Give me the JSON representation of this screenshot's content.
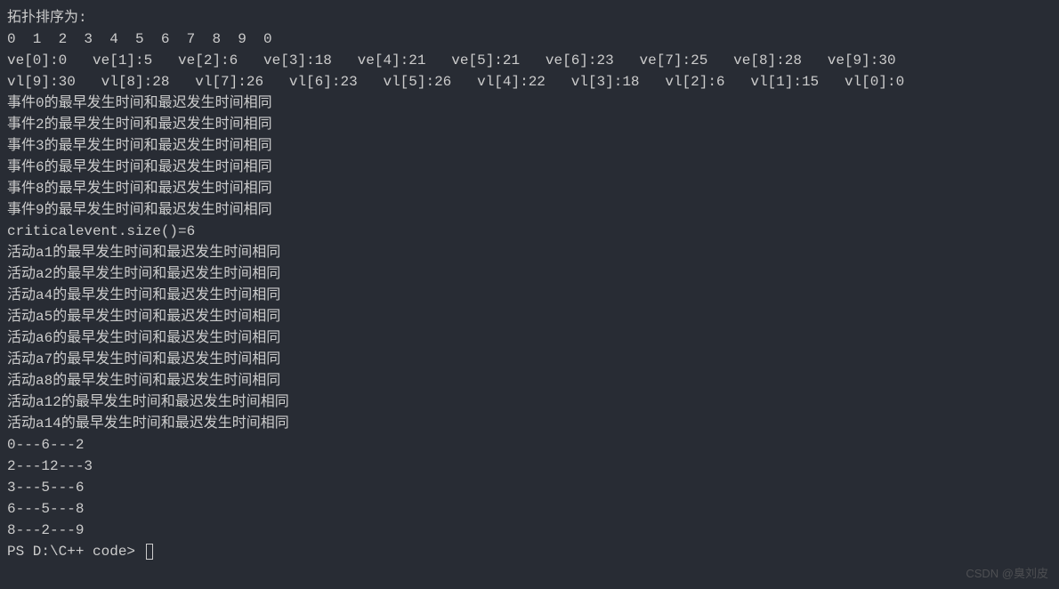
{
  "lines": {
    "header": "拓扑排序为:",
    "topo_order": "0  1  2  3  4  5  6  7  8  9  0",
    "ve_line": "ve[0]:0   ve[1]:5   ve[2]:6   ve[3]:18   ve[4]:21   ve[5]:21   ve[6]:23   ve[7]:25   ve[8]:28   ve[9]:30",
    "vl_line": "vl[9]:30   vl[8]:28   vl[7]:26   vl[6]:23   vl[5]:26   vl[4]:22   vl[3]:18   vl[2]:6   vl[1]:15   vl[0]:0",
    "event0": "事件0的最早发生时间和最迟发生时间相同",
    "event2": "事件2的最早发生时间和最迟发生时间相同",
    "event3": "事件3的最早发生时间和最迟发生时间相同",
    "event6": "事件6的最早发生时间和最迟发生时间相同",
    "event8": "事件8的最早发生时间和最迟发生时间相同",
    "event9": "事件9的最早发生时间和最迟发生时间相同",
    "critical_size": "criticalevent.size()=6",
    "activity_a1": "活动a1的最早发生时间和最迟发生时间相同",
    "activity_a2": "活动a2的最早发生时间和最迟发生时间相同",
    "activity_a4": "活动a4的最早发生时间和最迟发生时间相同",
    "activity_a5": "活动a5的最早发生时间和最迟发生时间相同",
    "activity_a6": "活动a6的最早发生时间和最迟发生时间相同",
    "activity_a7": "活动a7的最早发生时间和最迟发生时间相同",
    "activity_a8": "活动a8的最早发生时间和最迟发生时间相同",
    "activity_a12": "活动a12的最早发生时间和最迟发生时间相同",
    "activity_a14": "活动a14的最早发生时间和最迟发生时间相同",
    "path1": "0---6---2",
    "path2": "2---12---3",
    "path3": "3---5---6",
    "path4": "6---5---8",
    "path5": "8---2---9",
    "prompt": "PS D:\\C++ code> "
  },
  "watermark": "CSDN @臭刘皮"
}
